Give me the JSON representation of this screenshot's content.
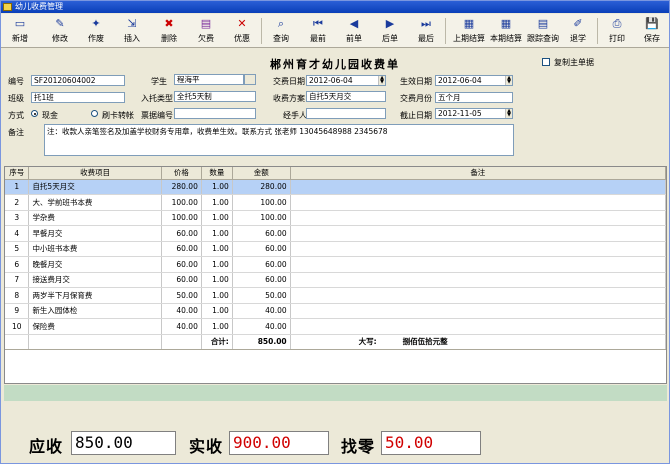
{
  "window": {
    "title": "幼儿收费管理"
  },
  "toolbar": [
    {
      "label": "新增",
      "icon": "new-icon"
    },
    {
      "label": "修改",
      "icon": "edit-icon"
    },
    {
      "label": "作废",
      "icon": "void-icon"
    },
    {
      "label": "插入",
      "icon": "insert-icon"
    },
    {
      "label": "删除",
      "icon": "delete-icon"
    },
    {
      "label": "欠费",
      "icon": "arrears-icon"
    },
    {
      "label": "优惠",
      "icon": "discount-icon"
    },
    {
      "label": "查询",
      "icon": "search-icon"
    },
    {
      "label": "最前",
      "icon": "first-icon"
    },
    {
      "label": "前单",
      "icon": "prev-icon"
    },
    {
      "label": "后单",
      "icon": "next-icon"
    },
    {
      "label": "最后",
      "icon": "last-icon"
    },
    {
      "label": "上期结算",
      "icon": "last-period-icon"
    },
    {
      "label": "本期结算",
      "icon": "this-period-icon"
    },
    {
      "label": "跟踪查询",
      "icon": "track-icon"
    },
    {
      "label": "退学",
      "icon": "withdraw-icon"
    },
    {
      "label": "打印",
      "icon": "print-icon"
    },
    {
      "label": "保存",
      "icon": "save-icon"
    }
  ],
  "form": {
    "title": "郴州育才幼儿园收费单",
    "copy_main_label": "复制主单据",
    "labels": {
      "number": "编号",
      "student": "学生",
      "pay_date": "交费日期",
      "effective_date": "生效日期",
      "class": "班级",
      "care_type": "入托类型",
      "scheme": "收费方案",
      "pay_months": "交费月份",
      "method": "方式",
      "cash": "现金",
      "card": "刷卡转帐",
      "receipt_no": "票据编号",
      "handler": "经手人",
      "end_date": "截止日期",
      "remark": "备注"
    },
    "values": {
      "number": "SF20120604002",
      "student": "程海平",
      "pay_date": "2012-06-04",
      "effective_date": "2012-06-04",
      "class": "托1班",
      "care_type": "全托5天制",
      "scheme": "自托5天月交",
      "pay_months": "五个月",
      "receipt_no": "",
      "handler": "",
      "end_date": "2012-11-05",
      "remark": "注：收款人亲笔签名及加盖学校财务专用章，收费单生效。联系方式 张老师 13045648988 2345678"
    },
    "method_selected": "现金"
  },
  "grid": {
    "headers": [
      "序号",
      "收费项目",
      "价格",
      "数量",
      "金额",
      "备注"
    ],
    "rows": [
      {
        "no": "1",
        "item": "自托5天月交",
        "price": "280.00",
        "qty": "1.00",
        "amount": "280.00",
        "note": ""
      },
      {
        "no": "2",
        "item": "大、学前班书本费",
        "price": "100.00",
        "qty": "1.00",
        "amount": "100.00",
        "note": ""
      },
      {
        "no": "3",
        "item": "学杂费",
        "price": "100.00",
        "qty": "1.00",
        "amount": "100.00",
        "note": ""
      },
      {
        "no": "4",
        "item": "早餐月交",
        "price": "60.00",
        "qty": "1.00",
        "amount": "60.00",
        "note": ""
      },
      {
        "no": "5",
        "item": "中小班书本费",
        "price": "60.00",
        "qty": "1.00",
        "amount": "60.00",
        "note": ""
      },
      {
        "no": "6",
        "item": "晚餐月交",
        "price": "60.00",
        "qty": "1.00",
        "amount": "60.00",
        "note": ""
      },
      {
        "no": "7",
        "item": "接送费月交",
        "price": "60.00",
        "qty": "1.00",
        "amount": "60.00",
        "note": ""
      },
      {
        "no": "8",
        "item": "两岁半下月保育费",
        "price": "50.00",
        "qty": "1.00",
        "amount": "50.00",
        "note": ""
      },
      {
        "no": "9",
        "item": "新生入园体检",
        "price": "40.00",
        "qty": "1.00",
        "amount": "40.00",
        "note": ""
      },
      {
        "no": "10",
        "item": "保险费",
        "price": "40.00",
        "qty": "1.00",
        "amount": "40.00",
        "note": ""
      }
    ],
    "total_label": "合计:",
    "total_amount": "850.00",
    "uppercase_label": "大写:",
    "uppercase_amount": "捌佰伍拾元整"
  },
  "summary": {
    "receivable_label": "应收",
    "receivable": "850.00",
    "received_label": "实收",
    "received": "900.00",
    "change_label": "找零",
    "change": "50.00"
  }
}
